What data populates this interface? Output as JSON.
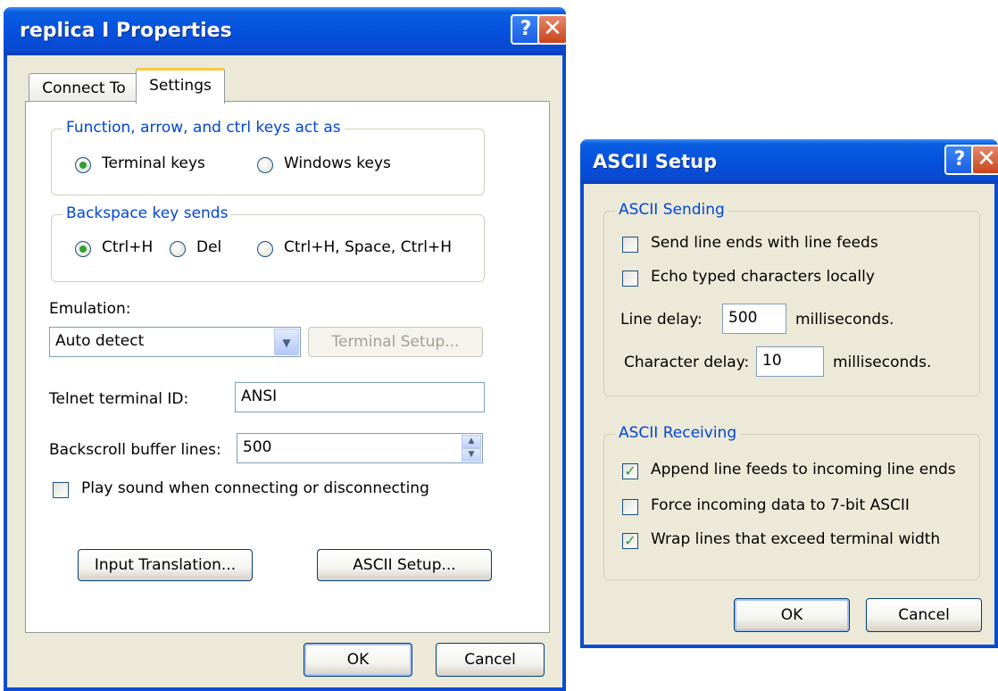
{
  "properties_dialog": {
    "title": "replica I Properties",
    "tabs": [
      "Connect To",
      "Settings"
    ],
    "active_tab": "Settings",
    "function_keys": {
      "legend": "Function, arrow, and ctrl keys act as",
      "options": [
        "Terminal keys",
        "Windows keys"
      ],
      "selected": "Terminal keys"
    },
    "backspace": {
      "legend": "Backspace key sends",
      "options": [
        "Ctrl+H",
        "Del",
        "Ctrl+H, Space, Ctrl+H"
      ],
      "selected": "Ctrl+H"
    },
    "emulation": {
      "label": "Emulation:",
      "value": "Auto detect",
      "terminal_setup_button": "Terminal Setup..."
    },
    "telnet_id": {
      "label": "Telnet terminal ID:",
      "value": "ANSI"
    },
    "backscroll": {
      "label": "Backscroll buffer lines:",
      "value": "500"
    },
    "play_sound": {
      "label": "Play sound when connecting or disconnecting",
      "checked": false
    },
    "input_translation_button": "Input Translation...",
    "ascii_setup_button": "ASCII Setup...",
    "ok_button": "OK",
    "cancel_button": "Cancel"
  },
  "ascii_dialog": {
    "title": "ASCII Setup",
    "sending": {
      "legend": "ASCII Sending",
      "send_line_ends": {
        "label": "Send line ends with line feeds",
        "checked": false
      },
      "echo_typed": {
        "label": "Echo typed characters locally",
        "checked": false
      },
      "line_delay": {
        "label": "Line delay:",
        "value": "500",
        "unit": "milliseconds."
      },
      "char_delay": {
        "label": "Character delay:",
        "value": "10",
        "unit": "milliseconds."
      }
    },
    "receiving": {
      "legend": "ASCII Receiving",
      "append_line_feeds": {
        "label": "Append line feeds to incoming line ends",
        "checked": true
      },
      "force_7bit": {
        "label": "Force incoming data to 7-bit ASCII",
        "checked": false
      },
      "wrap_lines": {
        "label": "Wrap lines that exceed terminal width",
        "checked": true
      }
    },
    "ok_button": "OK",
    "cancel_button": "Cancel"
  },
  "icons": {
    "help": "?",
    "close": "✕",
    "check": "✓",
    "dropdown": "▼",
    "spin_up": "▲",
    "spin_down": "▼"
  },
  "colors": {
    "titlebar": "#0551de",
    "dialog_bg": "#ece9d8",
    "group_legend": "#0046d5",
    "check_mark": "#21a121"
  }
}
